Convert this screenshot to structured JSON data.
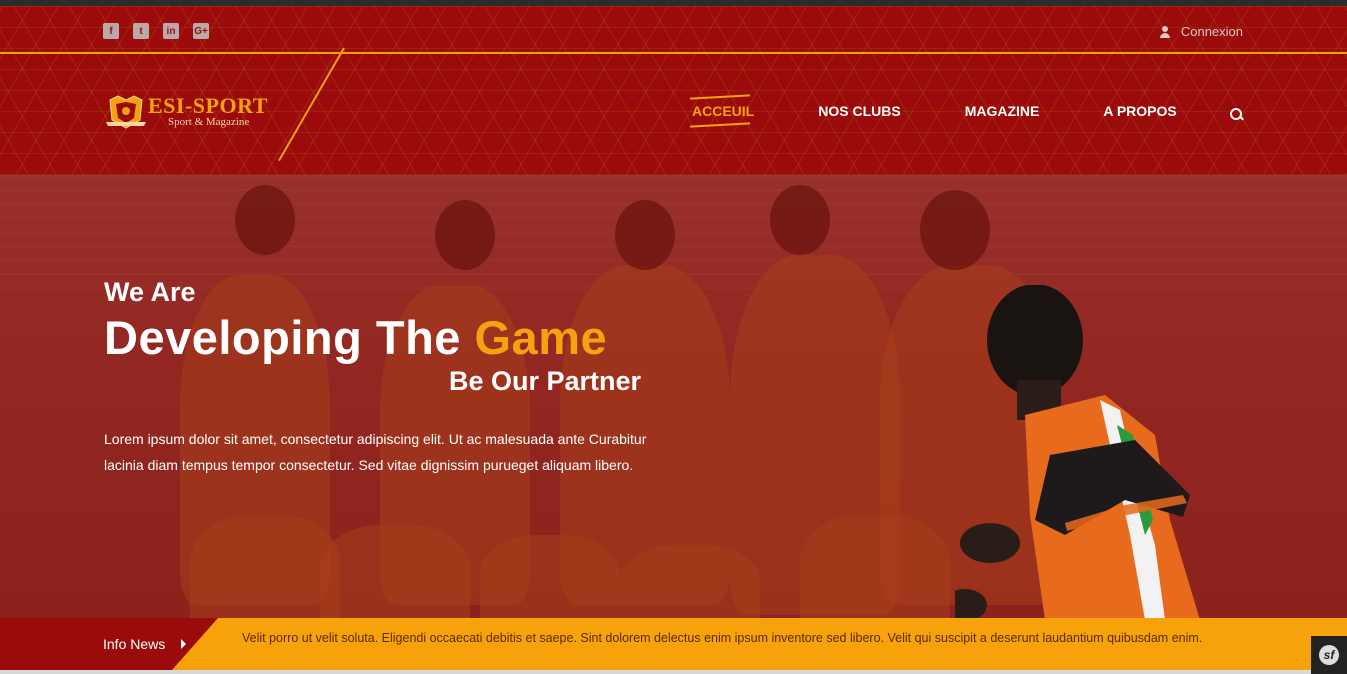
{
  "topbar": {
    "social": [
      {
        "icon": "facebook-icon",
        "glyph": "f"
      },
      {
        "icon": "twitter-icon",
        "glyph": "t"
      },
      {
        "icon": "linkedin-icon",
        "glyph": "in"
      },
      {
        "icon": "googleplus-icon",
        "glyph": "G+"
      }
    ],
    "login_label": "Connexion"
  },
  "brand": {
    "name": "ESI-SPORT",
    "tagline": "Sport & Magazine"
  },
  "nav": {
    "items": [
      "ACCEUIL",
      "NOS CLUBS",
      "MAGAZINE",
      "A PROPOS"
    ],
    "active_index": 0
  },
  "hero": {
    "line1": "We Are",
    "line2_main": "Developing The ",
    "line2_accent": "Game",
    "line3": "Be Our Partner",
    "description": "Lorem ipsum dolor sit amet, consectetur adipiscing elit. Ut ac malesuada ante Curabitur lacinia diam tempus tempor consectetur. Sed vitae dignissim purueget aliquam libero."
  },
  "ticker": {
    "label": "Info News",
    "text": "Velit porro ut velit soluta. Eligendi occaecati debitis et saepe. Sint dolorem delectus enim ipsum inventore sed libero. Velit qui suscipit a deserunt laudantium quibusdam enim."
  },
  "colors": {
    "primary": "#9b0b0b",
    "accent": "#f2a30f",
    "ticker_bg": "#f7a20a"
  }
}
